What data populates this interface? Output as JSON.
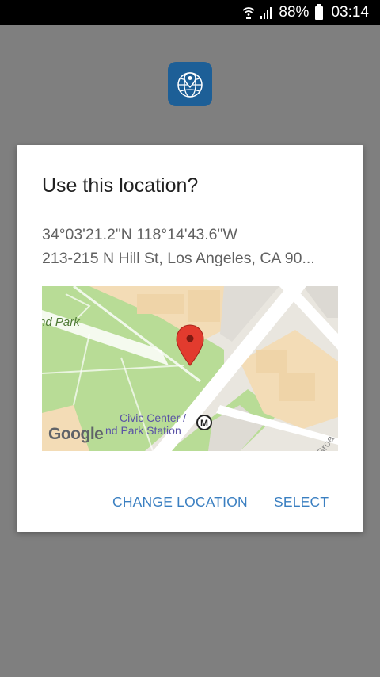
{
  "status_bar": {
    "battery_percent": "88%",
    "time": "03:14",
    "icons": [
      "wifi-calling-icon",
      "signal-icon",
      "battery-icon"
    ]
  },
  "app": {
    "icon": "globe-location-icon",
    "brand_color": "#1d5f97"
  },
  "dialog": {
    "title": "Use this location?",
    "coordinates": "34°03'21.2\"N 118°14'43.6\"W",
    "address": "213-215 N Hill St, Los Angeles, CA 90...",
    "map": {
      "labels": {
        "park_fragment": "nd Park",
        "station_line1": "Civic Center /",
        "station_line2": "nd Park Station",
        "street_fragment": "Broa",
        "attribution": "Google",
        "metro_badge": "M"
      },
      "marker": "red-location-pin-icon"
    },
    "buttons": {
      "change_location": "CHANGE LOCATION",
      "select": "SELECT"
    },
    "accent_color": "#3a7fc1"
  }
}
